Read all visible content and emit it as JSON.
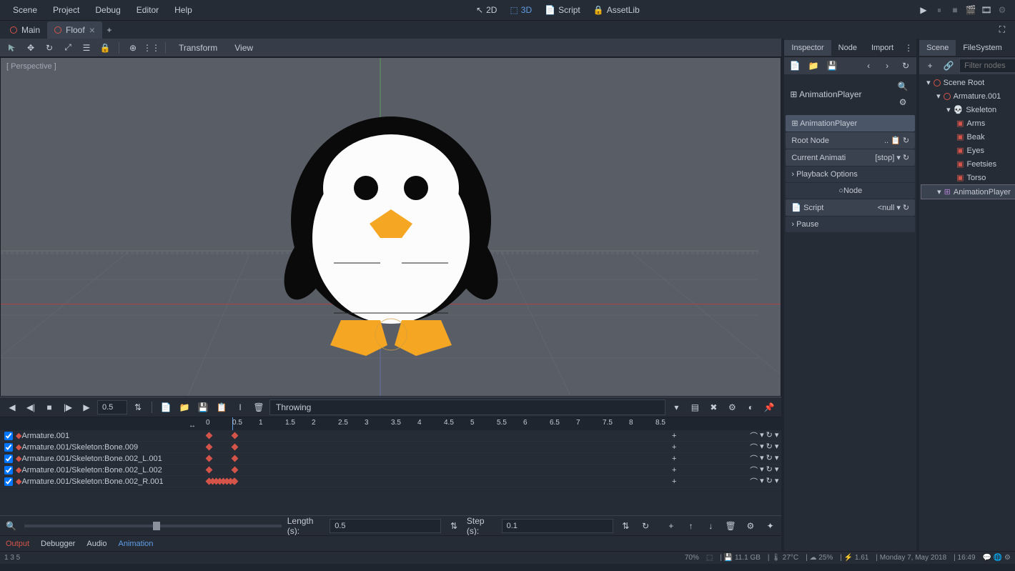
{
  "menubar": {
    "items": [
      "Scene",
      "Project",
      "Debug",
      "Editor",
      "Help"
    ],
    "center": {
      "btn2d": "2D",
      "btn3d": "3D",
      "script": "Script",
      "assetlib": "AssetLib"
    }
  },
  "tabs": [
    {
      "label": "Main",
      "active": false
    },
    {
      "label": "Floof",
      "active": true
    }
  ],
  "toolbar": {
    "transform": "Transform",
    "view": "View"
  },
  "viewport": {
    "perspective": "[ Perspective ]"
  },
  "animation": {
    "time_value": "0.5",
    "name": "Throwing",
    "ruler": [
      "0",
      "0.5",
      "1",
      "1.5",
      "2",
      "2.5",
      "3",
      "3.5",
      "4",
      "4.5",
      "5",
      "5.5",
      "6",
      "6.5",
      "7",
      "7.5",
      "8",
      "8.5"
    ],
    "tracks": [
      "Armature.001",
      "Armature.001/Skeleton:Bone.009",
      "Armature.001/Skeleton:Bone.002_L.001",
      "Armature.001/Skeleton:Bone.002_L.002",
      "Armature.001/Skeleton:Bone.002_R.001"
    ],
    "length_label": "Length (s):",
    "length_value": "0.5",
    "step_label": "Step (s):",
    "step_value": "0.1"
  },
  "bottom_tabs": {
    "output": "Output",
    "debugger": "Debugger",
    "audio": "Audio",
    "animation": "Animation"
  },
  "inspector": {
    "tabs": [
      "Inspector",
      "Node",
      "Import"
    ],
    "title": "AnimationPlayer",
    "rows": {
      "name": "AnimationPlayer",
      "root_node_label": "Root Node",
      "root_node_value": "..",
      "current_anim_label": "Current Animati",
      "current_anim_value": "[stop]",
      "playback": "Playback Options",
      "node_section": "Node",
      "script_label": "Script",
      "script_value": "<null",
      "pause": "Pause"
    }
  },
  "scene_panel": {
    "tabs": [
      "Scene",
      "FileSystem"
    ],
    "filter_placeholder": "Filter nodes",
    "tree": [
      {
        "label": "Scene Root",
        "indent": 0,
        "icon": "circle"
      },
      {
        "label": "Armature.001",
        "indent": 1,
        "icon": "circle"
      },
      {
        "label": "Skeleton",
        "indent": 2,
        "icon": "skeleton"
      },
      {
        "label": "Arms",
        "indent": 3,
        "icon": "mesh"
      },
      {
        "label": "Beak",
        "indent": 3,
        "icon": "mesh"
      },
      {
        "label": "Eyes",
        "indent": 3,
        "icon": "mesh"
      },
      {
        "label": "Feetsies",
        "indent": 3,
        "icon": "mesh"
      },
      {
        "label": "Torso",
        "indent": 3,
        "icon": "mesh"
      },
      {
        "label": "AnimationPlayer",
        "indent": 1,
        "icon": "anim",
        "selected": true
      }
    ]
  },
  "statusbar": {
    "left": "1  3  5",
    "percent": "70%",
    "mem": "11.1 GB",
    "temp": "27°C",
    "cpu": "25%",
    "load": "1.61",
    "date": "Monday  7, May 2018",
    "time": "16:49"
  }
}
